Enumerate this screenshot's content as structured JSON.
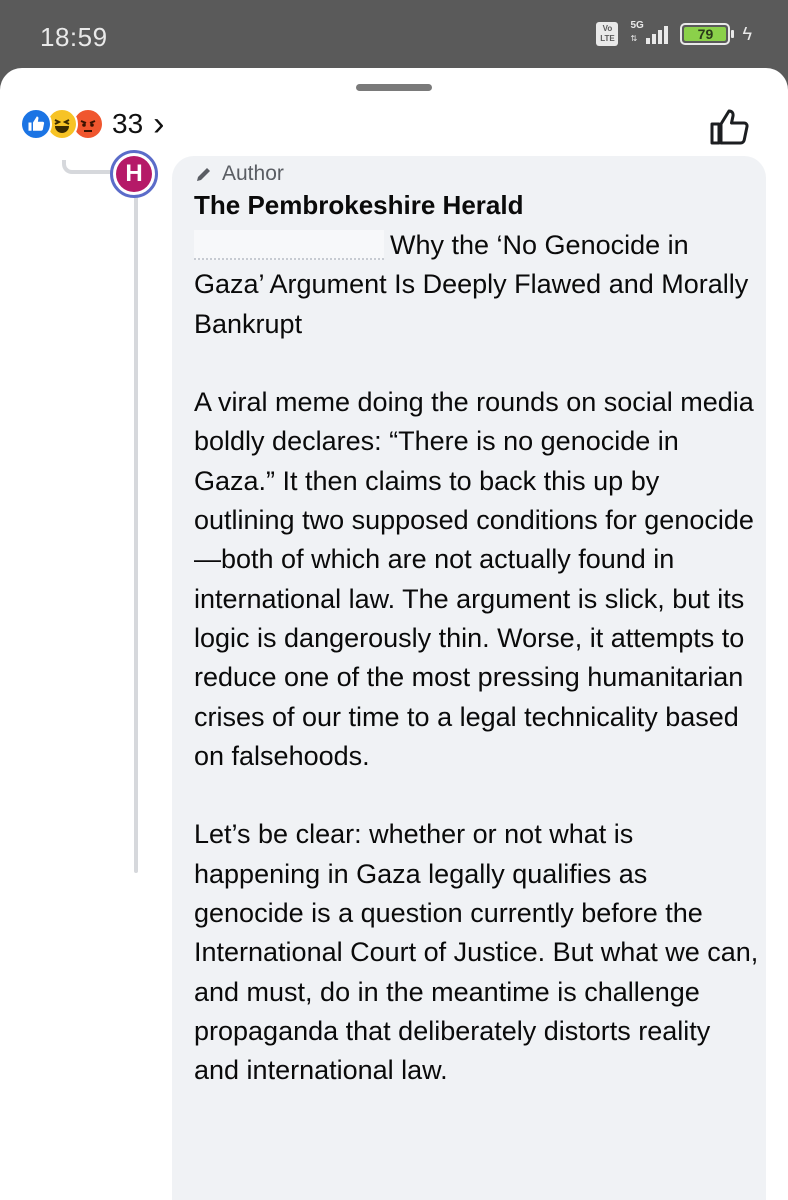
{
  "status_bar": {
    "time": "18:59",
    "volte": "Vo LTE",
    "network": "5G",
    "battery": "79"
  },
  "reactions": {
    "icons": [
      "like-icon",
      "haha-icon",
      "angry-icon"
    ],
    "count": "33",
    "chevron": "›"
  },
  "comment": {
    "badge": "Author",
    "author": "The Pembrokeshire Herald",
    "body": "Why the ‘No Genocide in Gaza’ Argument Is Deeply Flawed and Morally Bankrupt\n\nA viral meme doing the rounds on social media boldly declares: “There is no genocide in Gaza.” It then claims to back this up by outlining two supposed conditions for genocide—both of which are not actually found in international law. The argument is slick, but its logic is dangerously thin. Worse, it attempts to reduce one of the most pressing humanitarian crises of our time to a legal technicality based on falsehoods.\n\nLet’s be clear: whether or not what is happening in Gaza legally qualifies as genocide is a question currently before the International Court of Justice. But what we can, and must, do in the meantime is challenge propaganda that deliberately distorts reality and international law."
  },
  "colors": {
    "status_bar_bg": "#5a5a5a",
    "bubble_bg": "#f0f2f5",
    "like_blue": "#1b74e4",
    "avatar_magenta": "#b51a68",
    "avatar_ring": "#5b6cc9",
    "battery_green": "#8bd14a"
  }
}
